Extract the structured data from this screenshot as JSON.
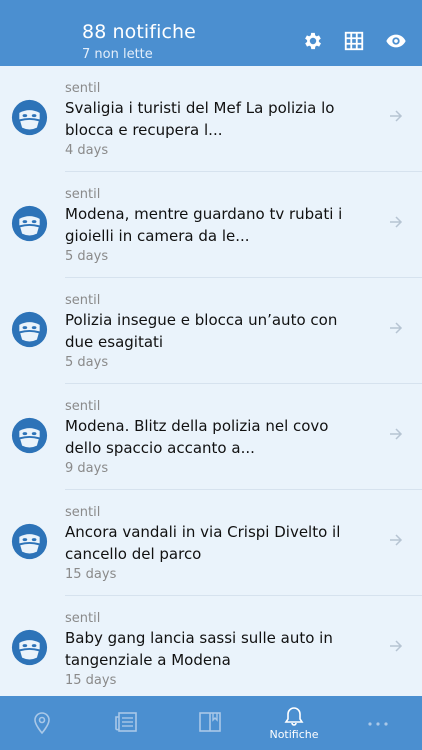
{
  "header": {
    "title": "88 notifiche",
    "subtitle": "7 non lette",
    "icons": [
      "gear-icon",
      "grid-icon",
      "eye-icon"
    ]
  },
  "notifications": [
    {
      "sender": "sentil",
      "text": "Svaligia i turisti del Mef La polizia lo blocca e recupera l...",
      "time": "4 days"
    },
    {
      "sender": "sentil",
      "text": "Modena, mentre guardano tv rubati i gioielli in camera da le...",
      "time": "5 days"
    },
    {
      "sender": "sentil",
      "text": "Polizia insegue e blocca un’auto con due esagitati",
      "time": "5 days"
    },
    {
      "sender": "sentil",
      "text": "Modena. Blitz della polizia nel covo dello spaccio accanto a...",
      "time": "9 days"
    },
    {
      "sender": "sentil",
      "text": "Ancora vandali in via Crispi Divelto il cancello del parco",
      "time": "15 days"
    },
    {
      "sender": "sentil",
      "text": "Baby gang lancia sassi sulle auto in tangenziale a Modena",
      "time": "15 days"
    }
  ],
  "tabbar": {
    "tabs": [
      {
        "icon": "map-pin-icon",
        "label": ""
      },
      {
        "icon": "news-icon",
        "label": ""
      },
      {
        "icon": "book-icon",
        "label": ""
      },
      {
        "icon": "bell-icon",
        "label": "Notifiche"
      },
      {
        "icon": "more-icon",
        "label": ""
      }
    ]
  },
  "colors": {
    "accent": "#4b8fd0",
    "background": "#eaf3fb"
  }
}
